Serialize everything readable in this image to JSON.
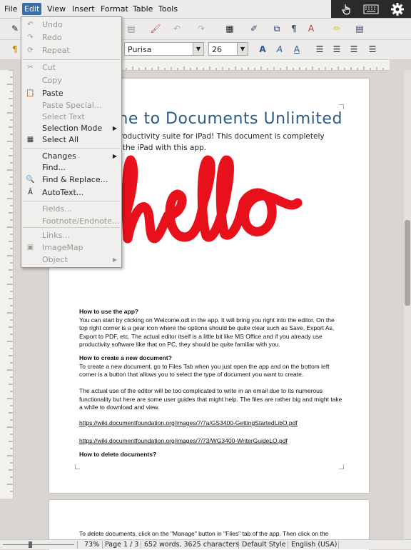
{
  "menubar": {
    "items": [
      "File",
      "Edit",
      "View",
      "Insert",
      "Format",
      "Table",
      "Tools"
    ]
  },
  "formatting": {
    "font_name": "Purisa",
    "font_size": "26"
  },
  "edit_menu": {
    "items": [
      {
        "label": "Undo",
        "disabled": true
      },
      {
        "label": "Redo",
        "disabled": true
      },
      {
        "label": "Repeat",
        "disabled": true
      },
      {
        "label": "Cut",
        "disabled": true
      },
      {
        "label": "Copy",
        "disabled": true
      },
      {
        "label": "Paste",
        "disabled": false
      },
      {
        "label": "Paste Special...",
        "disabled": true
      },
      {
        "label": "Select Text",
        "disabled": true
      },
      {
        "label": "Selection Mode",
        "disabled": false
      },
      {
        "label": "Select All",
        "disabled": false
      },
      {
        "label": "Changes",
        "disabled": false
      },
      {
        "label": "Find...",
        "disabled": false
      },
      {
        "label": "Find & Replace...",
        "disabled": false
      },
      {
        "label": "AutoText...",
        "disabled": false
      },
      {
        "label": "Fields...",
        "disabled": true
      },
      {
        "label": "Footnote/Endnote...",
        "disabled": true
      },
      {
        "label": "Links...",
        "disabled": true
      },
      {
        "label": "ImageMap",
        "disabled": true
      },
      {
        "label": "Object",
        "disabled": true
      }
    ]
  },
  "document": {
    "title": "me to Documents Unlimited",
    "subtitle_line1": "roductivity suite for iPad! This document is completely",
    "subtitle_line2": "the iPad with this app.",
    "drawing_text": "hello",
    "h1": "How to use the app?",
    "p1": "You can start by clicking on Welcome.odt in the app. It will bring you right into the editor. On the top right corner is a gear icon where the options should be quite clear such as Save, Export As, Export to PDF, etc. The actual editor itself is a little bit like MS Office and if you already use productivity software like that on PC, they should be quite familiar with you.",
    "h2": "How to create a new document?",
    "p2": "To create a new document, go to Files Tab when you just open the app and on the bottom left corner is a button that allows you to select the type of document you want to create.",
    "p3": "The actual use of the editor will be too complicated to write in an email due to its numerous functionality but here are some user guides that might help. The files are rather big and might take a while to download and view.",
    "link1": "https://wiki.documentfoundation.org/images/7/7a/GS3400-GettingStartedLibO.pdf",
    "link2": "https://wiki.documentfoundation.org/images/7/73/WG3400-WriterGuideLO.pdf",
    "h3": "How to delete documents?",
    "p4": "To delete documents, click on the \"Manage\" button in \"Files\" tab of the app. Then click on the"
  },
  "statusbar": {
    "zoom": "73%",
    "page": "Page 1 / 3",
    "words": "652 words, 3625 characters",
    "style": "Default Style",
    "language": "English (USA)"
  },
  "colors": {
    "accent": "#3b6ea8",
    "hello": "#e8101a",
    "title": "#2e5b8a"
  }
}
